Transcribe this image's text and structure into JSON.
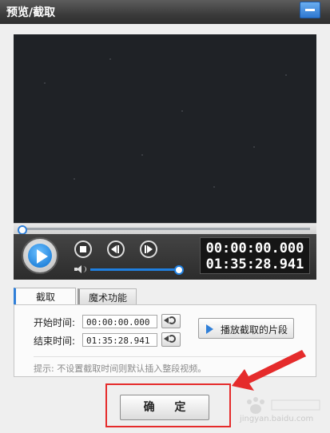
{
  "window": {
    "title": "预览/截取"
  },
  "player": {
    "current_time": "00:00:00.000",
    "total_time": "01:35:28.941"
  },
  "tabs": [
    {
      "label": "截取",
      "active": true
    },
    {
      "label": "魔术功能",
      "active": false
    }
  ],
  "clip": {
    "start_label": "开始时间:",
    "start_value": "00:00:00.000",
    "end_label": "结束时间:",
    "end_value": "01:35:28.941",
    "play_segment_label": "播放截取的片段",
    "hint": "提示: 不设置截取时间则默认插入整段视频。"
  },
  "confirm_label": "确 定",
  "watermark": {
    "text": "jingyan.baidu.com"
  },
  "colors": {
    "accent": "#2f7fd8",
    "highlight": "#e52b2b"
  }
}
